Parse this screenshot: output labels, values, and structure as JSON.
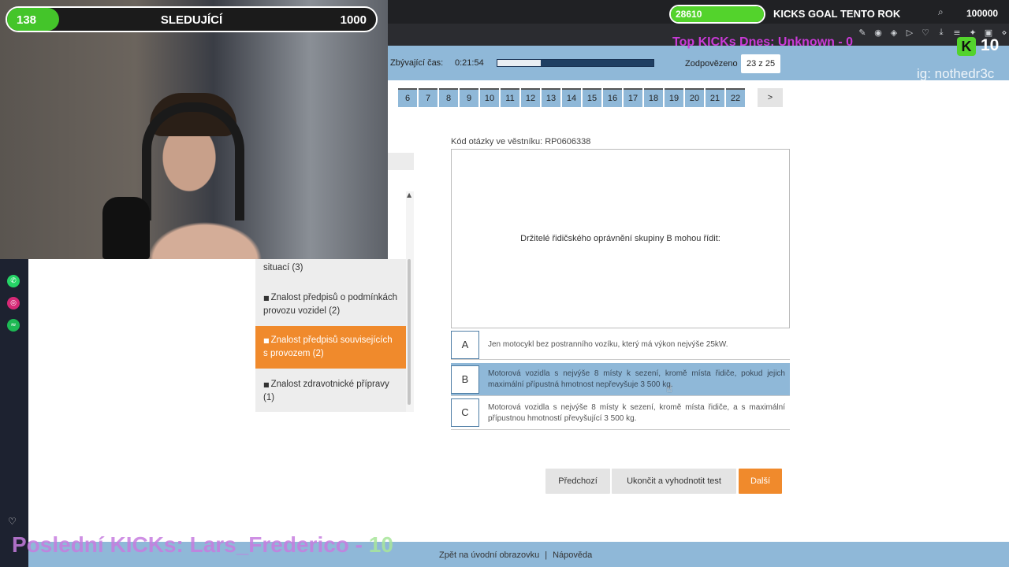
{
  "test": {
    "time_label": "Zbývající čas:",
    "time_value": "0:21:54",
    "time_progress": 0.28,
    "answered_label": "Zodpovězeno",
    "answered_value": "23 z 25",
    "question_numbers": [
      "6",
      "7",
      "8",
      "9",
      "10",
      "11",
      "12",
      "13",
      "14",
      "15",
      "16",
      "17",
      "18",
      "19",
      "20",
      "21",
      "22"
    ],
    "next_page": ">",
    "question_code": "Kód otázky ve věstníku: RP0606338",
    "question_text": "Držitelé řidičského oprávnění skupiny B mohou řídit:",
    "answers": [
      {
        "letter": "A",
        "text": "Jen motocykl bez postranního vozíku, který má výkon nejvýše 25kW."
      },
      {
        "letter": "B",
        "text": "Motorová vozidla s nejvýše 8 místy k sezení, kromě místa řidiče, pokud jejich maximální přípustná hmotnost nepřevyšuje 3 500 kg."
      },
      {
        "letter": "C",
        "text": "Motorová vozidla s nejvýše 8 místy k sezení, kromě místa řidiče, a s maximální přípustnou hmotností převyšující 3 500 kg."
      }
    ],
    "selected_answer": "B",
    "buttons": {
      "prev": "Předchozí",
      "finish": "Ukončit a vyhodnotit test",
      "next": "Další"
    }
  },
  "categories": [
    {
      "bullet": "",
      "label": "situací (3)",
      "active": false
    },
    {
      "bullet": "■",
      "label": "Znalost předpisů o podmínkách provozu vozidel (2)",
      "active": false
    },
    {
      "bullet": "■",
      "label": "Znalost předpisů souvisejících s provozem (2)",
      "active": true
    },
    {
      "bullet": "■",
      "label": "Znalost zdravotnické přípravy (1)",
      "active": false
    }
  ],
  "footer": {
    "home_link": "Zpět na úvodní obrazovku",
    "separator": "|",
    "help_link": "Nápověda"
  },
  "overlay": {
    "follow": {
      "current": "138",
      "title": "SLEDUJÍCÍ",
      "goal": "1000",
      "progress": 0.138
    },
    "kicks": {
      "current": "28610",
      "title": "KICKS GOAL TENTO ROK",
      "goal": "100000",
      "progress": 0.286
    },
    "top_kicks": "Top KICKs Dnes: Unknown - 0",
    "kicks_count": "10",
    "ig": "ig: nothedr3c",
    "last_kicks_label": "Poslední KICKs: Lars_Frederico - ",
    "last_kicks_value": "10"
  },
  "colors": {
    "accent_blue": "#8fb8d8",
    "accent_orange": "#f08a2c",
    "kick_green": "#53d32c"
  }
}
